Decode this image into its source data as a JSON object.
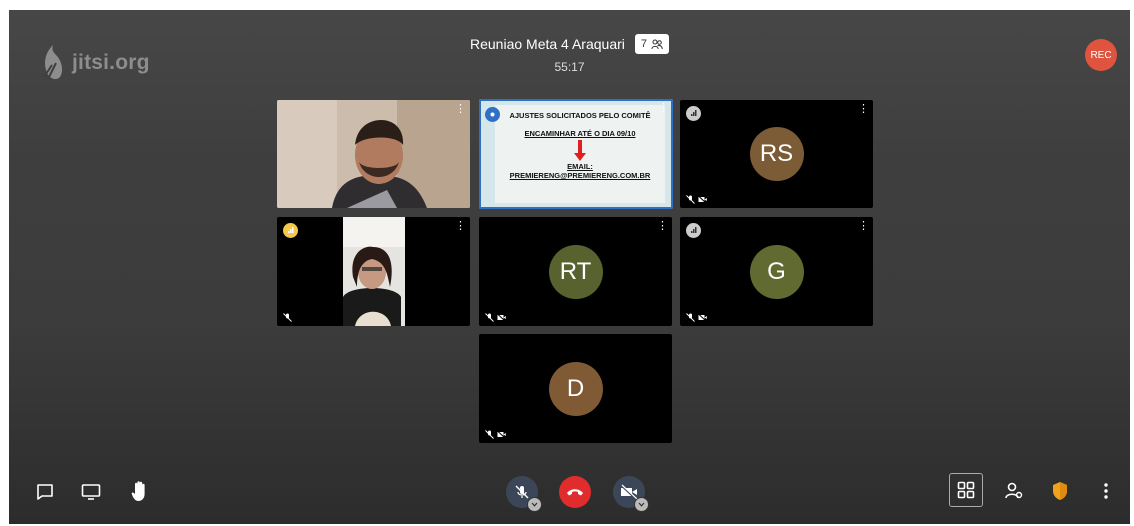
{
  "app": {
    "logo_text": "jitsi.org",
    "rec_label": "REC"
  },
  "meeting": {
    "title": "Reuniao Meta 4 Araquari",
    "participant_count": "7",
    "timer": "55:17"
  },
  "tiles": [
    {
      "id": "video1",
      "type": "video"
    },
    {
      "id": "screen",
      "type": "slide"
    },
    {
      "id": "rs",
      "initials": "RS",
      "color": "#7c5b37"
    },
    {
      "id": "video2",
      "type": "video"
    },
    {
      "id": "rt",
      "initials": "RT",
      "color": "#58622e"
    },
    {
      "id": "g",
      "initials": "G",
      "color": "#616a30"
    },
    {
      "id": "d",
      "initials": "D",
      "color": "#7f5a35"
    }
  ],
  "slide": {
    "line1": "AJUSTES SOLICITADOS PELO COMITÊ",
    "line2": "ENCAMINHAR ATÉ O DIA 09/10",
    "line3": "EMAIL:",
    "line4": "PREMIERENG@PREMIERENG.COM.BR"
  },
  "colors": {
    "hangup": "#e02c2c",
    "rec": "#e0533e",
    "shield": "#f2a21a",
    "signal_good": "#f2c94c"
  }
}
